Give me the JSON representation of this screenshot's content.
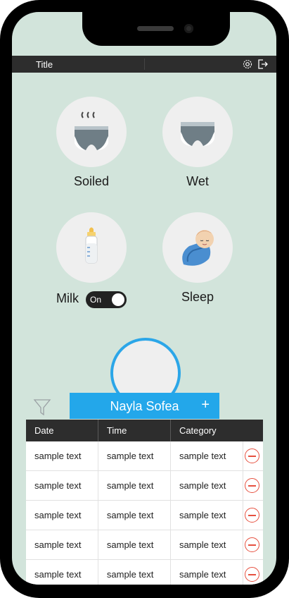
{
  "header": {
    "title": "Title",
    "settings_icon": "gear-icon",
    "logout_icon": "logout-icon"
  },
  "tiles": {
    "soiled": {
      "label": "Soiled",
      "icon": "soiled-diaper-icon"
    },
    "wet": {
      "label": "Wet",
      "icon": "wet-diaper-icon"
    },
    "milk": {
      "label": "Milk",
      "icon": "milk-bottle-icon",
      "toggle_state": "On"
    },
    "sleep": {
      "label": "Sleep",
      "icon": "sleeping-baby-icon"
    }
  },
  "child": {
    "name": "Nayla Sofea",
    "add_icon": "plus-icon",
    "filter_icon": "filter-icon"
  },
  "colors": {
    "accent": "#23a7ea",
    "background": "#d2e4db",
    "delete": "#e6503f",
    "dark": "#2d2d2d"
  },
  "table": {
    "columns": [
      "Date",
      "Time",
      "Category"
    ],
    "rows": [
      [
        "sample text",
        "sample text",
        "sample text"
      ],
      [
        "sample text",
        "sample text",
        "sample text"
      ],
      [
        "sample text",
        "sample text",
        "sample text"
      ],
      [
        "sample text",
        "sample text",
        "sample text"
      ],
      [
        "sample text",
        "sample text",
        "sample text"
      ]
    ]
  }
}
